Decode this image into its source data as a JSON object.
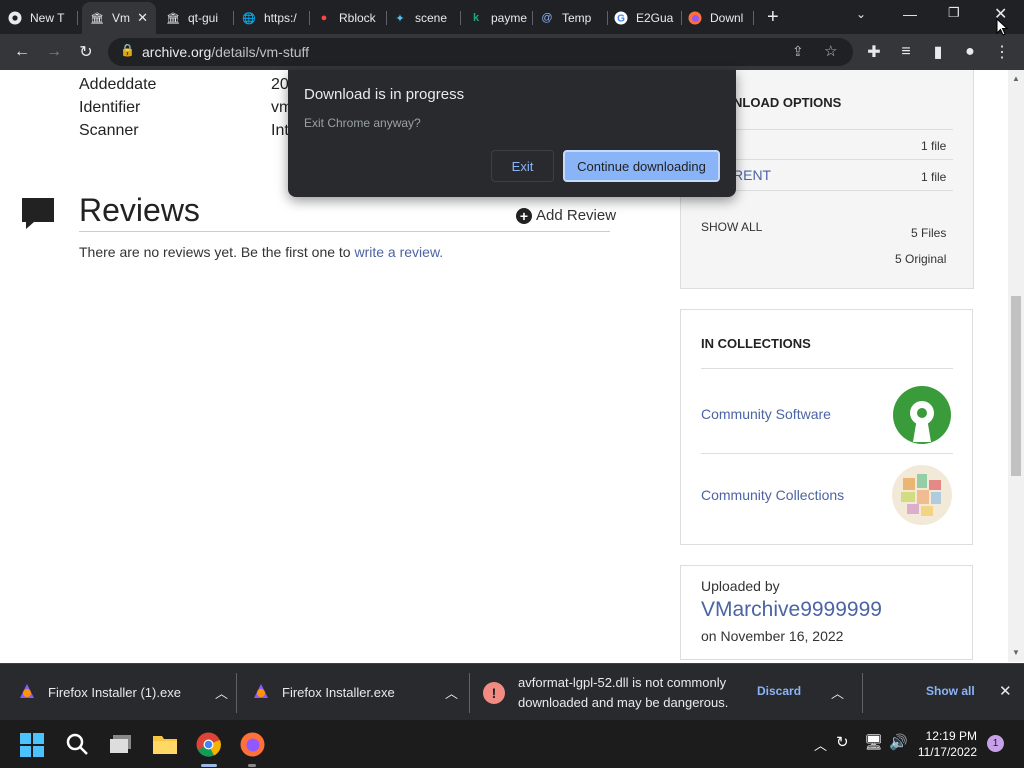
{
  "tabs": [
    {
      "label": "New T",
      "icon": "chrome-icon"
    },
    {
      "label": "Vm",
      "icon": "archive-icon"
    },
    {
      "label": "qt-gui",
      "icon": "archive-icon"
    },
    {
      "label": "https:/",
      "icon": "globe-icon"
    },
    {
      "label": "Rblock",
      "icon": "rblock-icon"
    },
    {
      "label": "scene",
      "icon": "scene-icon"
    },
    {
      "label": "payme",
      "icon": "k-icon"
    },
    {
      "label": "Temp",
      "icon": "at-icon"
    },
    {
      "label": "E2Gua",
      "icon": "google-icon"
    },
    {
      "label": "Downl",
      "icon": "firefox-icon"
    }
  ],
  "url": {
    "host": "archive.org",
    "path": "/details/vm-stuff"
  },
  "metadata": [
    {
      "label": "Addeddate",
      "value": "20"
    },
    {
      "label": "Identifier",
      "value": "vm"
    },
    {
      "label": "Scanner",
      "value": "Int"
    }
  ],
  "reviews": {
    "title": "Reviews",
    "add_label": "Add Review",
    "empty_text": "There are no reviews yet. Be the first one to ",
    "empty_link": "write a review."
  },
  "downloads": {
    "heading": "NLOAD OPTIONS",
    "row1_count": "1 file",
    "row2_label": "RENT",
    "row2_count": "1 file",
    "show_all": "SHOW ALL",
    "files": "5 Files",
    "original": "5 Original"
  },
  "collections": {
    "heading": "IN COLLECTIONS",
    "items": [
      "Community Software",
      "Community Collections"
    ]
  },
  "uploader": {
    "label": "Uploaded by",
    "name": "VMarchive9999999",
    "date": "on November 16, 2022"
  },
  "dialog": {
    "title": "Download is in progress",
    "subtitle": "Exit Chrome anyway?",
    "exit_label": "Exit",
    "continue_label": "Continue downloading"
  },
  "shelf": {
    "items": [
      "Firefox Installer (1).exe",
      "Firefox Installer.exe"
    ],
    "warning_line1": "avformat-lgpl-52.dll is not commonly",
    "warning_line2": "downloaded and may be dangerous.",
    "discard_label": "Discard",
    "show_all_label": "Show all"
  },
  "clock": {
    "time": "12:19 PM",
    "date": "11/17/2022",
    "notifications": "1"
  },
  "colors": {
    "accent": "#8ab4f8",
    "link": "#4b64a4",
    "danger": "#f28b82"
  }
}
